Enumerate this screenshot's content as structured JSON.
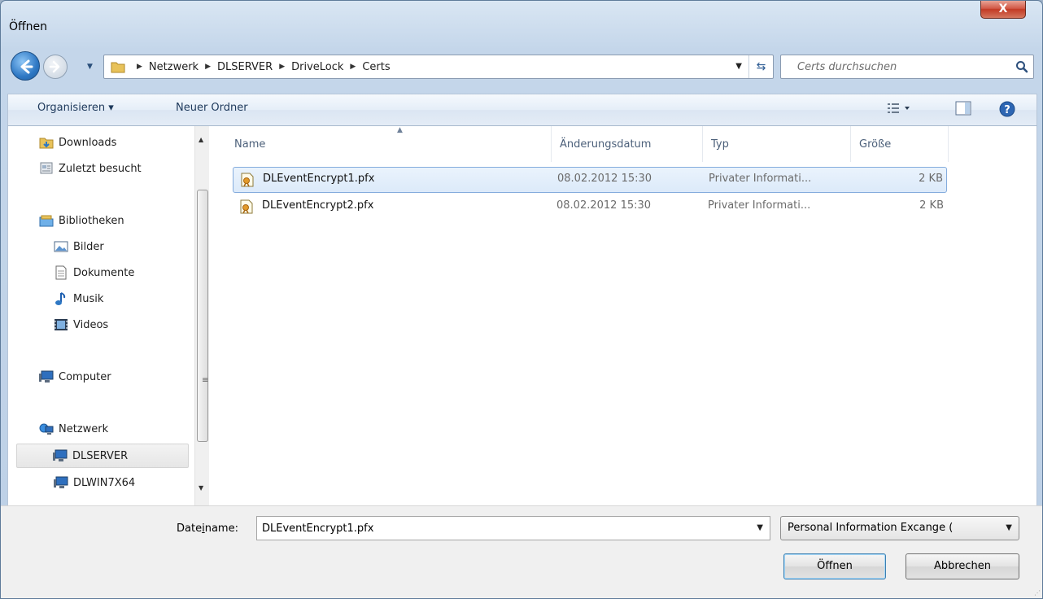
{
  "window": {
    "title": "Öffnen",
    "close_label": "X"
  },
  "nav": {
    "crumbs": [
      "Netzwerk",
      "DLSERVER",
      "DriveLock",
      "Certs"
    ],
    "search_placeholder": "Certs durchsuchen"
  },
  "toolbar": {
    "organize_label": "Organisieren ▾",
    "new_folder_label": "Neuer Ordner"
  },
  "sidebar": {
    "items": [
      {
        "label": "Downloads",
        "icon": "downloads-folder-icon"
      },
      {
        "label": "Zuletzt besucht",
        "icon": "recent-places-icon"
      },
      {
        "label": "Bibliotheken",
        "icon": "libraries-icon"
      },
      {
        "label": "Bilder",
        "icon": "pictures-icon"
      },
      {
        "label": "Dokumente",
        "icon": "documents-icon"
      },
      {
        "label": "Musik",
        "icon": "music-icon"
      },
      {
        "label": "Videos",
        "icon": "videos-icon"
      },
      {
        "label": "Computer",
        "icon": "computer-icon"
      },
      {
        "label": "Netzwerk",
        "icon": "network-icon"
      },
      {
        "label": "DLSERVER",
        "icon": "network-computer-icon",
        "selected": true
      },
      {
        "label": "DLWIN7X64",
        "icon": "network-computer-icon"
      }
    ]
  },
  "files": {
    "columns": [
      "Name",
      "Änderungsdatum",
      "Typ",
      "Größe"
    ],
    "rows": [
      {
        "name": "DLEventEncrypt1.pfx",
        "date": "08.02.2012 15:30",
        "type": "Privater Informati...",
        "size": "2 KB",
        "selected": true
      },
      {
        "name": "DLEventEncrypt2.pfx",
        "date": "08.02.2012 15:30",
        "type": "Privater Informati...",
        "size": "2 KB",
        "selected": false
      }
    ]
  },
  "bottom": {
    "filename_label_pre": "Date",
    "filename_label_ul": "i",
    "filename_label_post": "name:",
    "filename_value": "DLEventEncrypt1.pfx",
    "filter_value": "Personal Information Excange (",
    "open_label": "Öffnen",
    "cancel_label": "Abbrechen"
  },
  "colors": {
    "accent": "#3c7fb1",
    "selection": "#dceafa",
    "close_red": "#c23a24"
  }
}
